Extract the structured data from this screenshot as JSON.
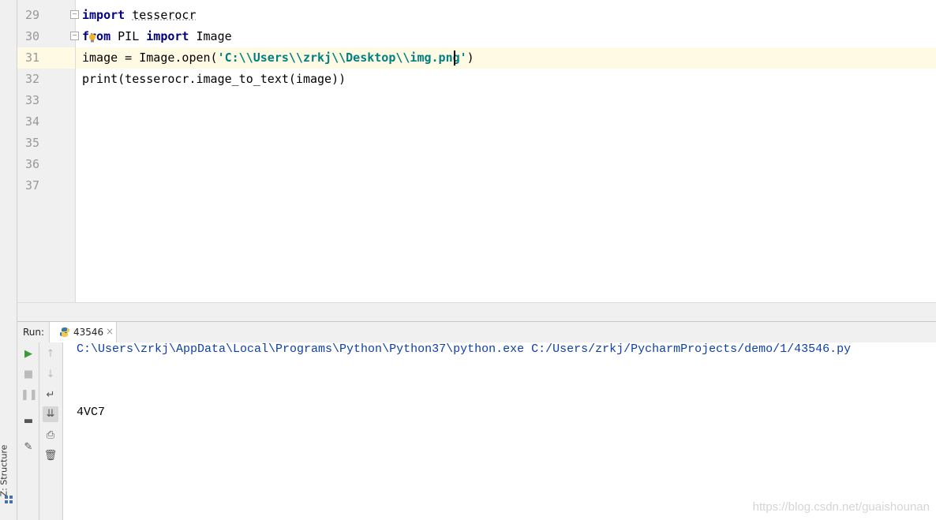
{
  "editor": {
    "lines": [
      {
        "num": "29",
        "parts": [
          {
            "t": "import",
            "c": "kw"
          },
          {
            "t": " ",
            "c": ""
          },
          {
            "t": "tesserocr",
            "c": "squiggle"
          }
        ]
      },
      {
        "num": "30",
        "parts": [
          {
            "t": "from",
            "c": "kw"
          },
          {
            "t": " PIL ",
            "c": ""
          },
          {
            "t": "import",
            "c": "kw"
          },
          {
            "t": " Image",
            "c": ""
          }
        ]
      },
      {
        "num": "31",
        "parts": [
          {
            "t": "image = Image.open(",
            "c": ""
          },
          {
            "t": "'C:\\\\Users\\\\zrkj\\\\Desktop\\\\img.png'",
            "c": "str"
          },
          {
            "t": ")",
            "c": ""
          }
        ]
      },
      {
        "num": "32",
        "parts": [
          {
            "t": "print(tesserocr.image_to_text(image))",
            "c": ""
          }
        ]
      },
      {
        "num": "33",
        "parts": []
      },
      {
        "num": "34",
        "parts": []
      },
      {
        "num": "35",
        "parts": []
      },
      {
        "num": "36",
        "parts": []
      },
      {
        "num": "37",
        "parts": []
      }
    ]
  },
  "left_strip": {
    "structure_label": "Z: Structure"
  },
  "run_panel": {
    "run_label": "Run:",
    "tab_label": "43546",
    "tab_close": "×",
    "console": {
      "command": "C:\\Users\\zrkj\\AppData\\Local\\Programs\\Python\\Python37\\python.exe C:/Users/zrkj/PycharmProjects/demo/1/43546.py",
      "output": "4VC7"
    }
  },
  "watermark": "https://blog.csdn.net/guaishounan",
  "colors": {
    "keyword": "#000080",
    "string": "#008080",
    "current_line": "#fffae3",
    "console_path": "#0d3fa6"
  }
}
